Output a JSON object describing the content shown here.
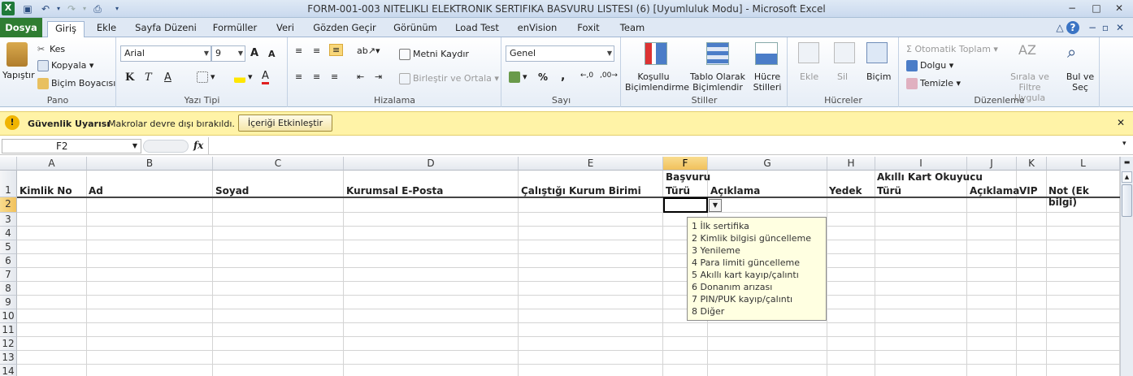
{
  "window": {
    "title": "FORM-001-003 NITELIKLI ELEKTRONIK SERTIFIKA BASVURU LISTESI (6)  [Uyumluluk Modu]  -  Microsoft Excel",
    "app_icon": "excel-icon",
    "controls": {
      "minimize": "−",
      "maximize": "□",
      "close": "✕"
    }
  },
  "tabs": [
    "Dosya",
    "Giriş",
    "Ekle",
    "Sayfa Düzeni",
    "Formüller",
    "Veri",
    "Gözden Geçir",
    "Görünüm",
    "Load Test",
    "enVision",
    "Foxit",
    "Team"
  ],
  "active_tab": "Giriş",
  "ribbon": {
    "pano": {
      "label": "Pano",
      "paste": "Yapıştır",
      "cut": "Kes",
      "copy": "Kopyala",
      "format_painter": "Biçim Boyacısı"
    },
    "yazi_tipi": {
      "label": "Yazı Tipi",
      "font": "Arial",
      "size": "9",
      "bold": "K",
      "italic": "T",
      "underline": "A",
      "grow": "A",
      "shrink": "A"
    },
    "hizalama": {
      "label": "Hizalama",
      "wrap": "Metni Kaydır",
      "merge": "Birleştir ve Ortala"
    },
    "sayi": {
      "label": "Sayı",
      "format": "Genel",
      "percent": "%",
      "comma": ","
    },
    "stiller": {
      "label": "Stiller",
      "conditional": "Koşullu Biçimlendirme",
      "table": "Tablo Olarak Biçimlendir",
      "cell_styles": "Hücre Stilleri"
    },
    "hucreler": {
      "label": "Hücreler",
      "insert": "Ekle",
      "delete": "Sil",
      "format": "Biçim"
    },
    "duzenleme": {
      "label": "Düzenleme",
      "autosum": "Otomatik Toplam",
      "fill": "Dolgu",
      "clear": "Temizle",
      "sort": "Sırala ve Filtre Uygula",
      "find": "Bul ve Seç"
    }
  },
  "security_bar": {
    "title": "Güvenlik Uyarısı",
    "message": "Makrolar devre dışı bırakıldı.",
    "button": "İçeriği Etkinleştir",
    "close": "✕"
  },
  "formula_bar": {
    "name_box": "F2",
    "fx": "fx",
    "value": ""
  },
  "columns": [
    "A",
    "B",
    "C",
    "D",
    "E",
    "F",
    "G",
    "H",
    "I",
    "J",
    "K",
    "L"
  ],
  "selected_column": "F",
  "rows": [
    "1",
    "2",
    "3",
    "4",
    "5",
    "6",
    "7",
    "8",
    "9",
    "10",
    "11",
    "12",
    "13",
    "14"
  ],
  "selected_row": "2",
  "headers": {
    "A": "Kimlik No",
    "B": "Ad",
    "C": "Soyad",
    "D": "Kurumsal E-Posta",
    "E": "Çalıştığı Kurum Birimi",
    "F_line1": "Başvuru",
    "F_line2": "Türü",
    "G": "Açıklama",
    "H": "Yedek",
    "I_line1": "Akıllı Kart Okuyucu",
    "I_line2": "Türü",
    "J": "Açıklama",
    "K": "VIP",
    "L": "Not (Ek bilgi)"
  },
  "validation_list": [
    "1 İlk sertifika",
    "2 Kimlik bilgisi güncelleme",
    "3 Yenileme",
    "4 Para limiti güncelleme",
    "5 Akıllı kart kayıp/çalıntı",
    "6 Donanım arızası",
    "7 PIN/PUK kayıp/çalıntı",
    "8 Diğer"
  ]
}
